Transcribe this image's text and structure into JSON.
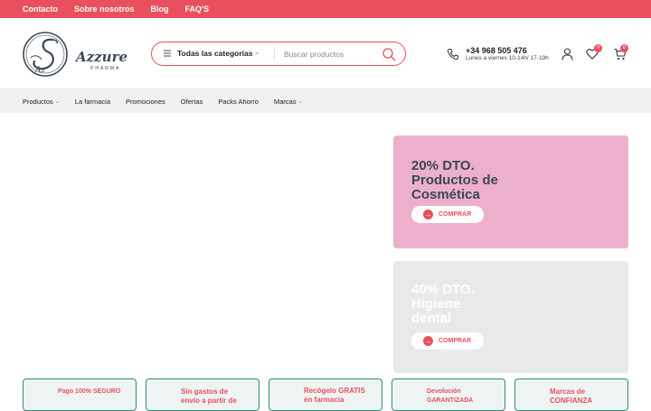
{
  "topbar": {
    "links": [
      "Contacto",
      "Sobre nosotros",
      "Blog",
      "FAQ'S"
    ]
  },
  "logo": {
    "name": "Azzure",
    "subtitle": "PHARMA",
    "monogram": "Az"
  },
  "search": {
    "category_label": "Todas las categorías",
    "placeholder": "Buscar productos"
  },
  "contact": {
    "phone": "+34 968 505 476",
    "hours": "Lunes a viernes 10-14h/ 17-19h"
  },
  "header_icons": {
    "user": "user-icon",
    "wishlist": "heart-icon",
    "wishlist_count": "0",
    "cart": "cart-icon",
    "cart_count": "0"
  },
  "nav": {
    "items": [
      {
        "label": "Productos",
        "has_dropdown": true
      },
      {
        "label": "La farmacia",
        "has_dropdown": false
      },
      {
        "label": "Promociones",
        "has_dropdown": false
      },
      {
        "label": "Ofertas",
        "has_dropdown": false
      },
      {
        "label": "Packs Ahorro",
        "has_dropdown": false
      },
      {
        "label": "Marcas",
        "has_dropdown": true
      }
    ]
  },
  "promos": [
    {
      "line1": "20% DTO.",
      "line2": "Productos de",
      "line3": "Cosmética",
      "button": "COMPRAR",
      "bg": "#ecb0cc"
    },
    {
      "line1": "40% DTO.",
      "line2": "Higiene",
      "line3": "dental",
      "button": "COMPRAR",
      "bg": "#e8e9eb"
    }
  ],
  "features": [
    {
      "line1": "Pago 100% SEGURO",
      "line2": ""
    },
    {
      "line1": "Sin gastos de",
      "line2": "envío a partir de"
    },
    {
      "line1": "Recógelo GRATIS",
      "line2": "en farmacia"
    },
    {
      "line1": "Devolución",
      "line2": "GARANTIZADA"
    },
    {
      "line1": "Marcas de",
      "line2": "CONFIANZA"
    }
  ],
  "colors": {
    "accent": "#e94f5c",
    "brand_dark": "#3c4758",
    "feature_border": "#2f8a78"
  }
}
